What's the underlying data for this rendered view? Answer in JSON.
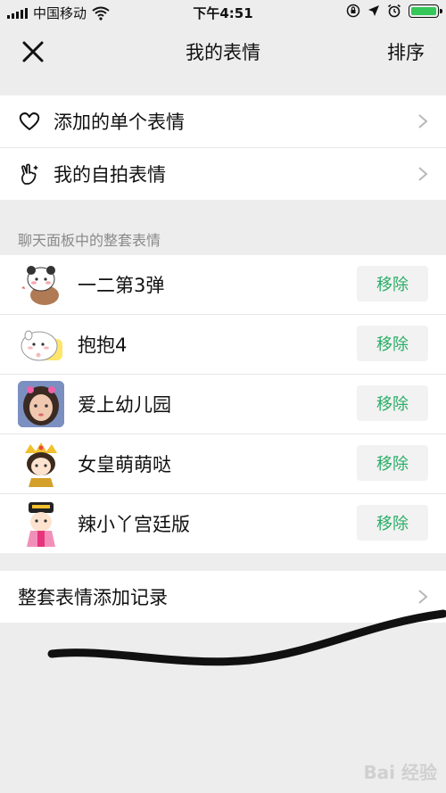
{
  "status_bar": {
    "carrier": "中国移动",
    "time": "下午4:51"
  },
  "header": {
    "title": "我的表情",
    "right_action": "排序"
  },
  "top_items": [
    {
      "label": "添加的单个表情",
      "icon": "heart-icon"
    },
    {
      "label": "我的自拍表情",
      "icon": "hand-icon"
    }
  ],
  "section": {
    "title": "聊天面板中的整套表情"
  },
  "packs": [
    {
      "name": "一二第3弹",
      "remove_label": "移除",
      "thumb": "bear-panda-sticker"
    },
    {
      "name": "抱抱4",
      "remove_label": "移除",
      "thumb": "round-character-sticker"
    },
    {
      "name": "爱上幼儿园",
      "remove_label": "移除",
      "thumb": "child-photo-sticker"
    },
    {
      "name": "女皇萌萌哒",
      "remove_label": "移除",
      "thumb": "empress-sticker"
    },
    {
      "name": "辣小丫宫廷版",
      "remove_label": "移除",
      "thumb": "palace-girl-sticker"
    }
  ],
  "bottom_item": {
    "label": "整套表情添加记录"
  },
  "colors": {
    "background": "#ededed",
    "remove_text": "#2aae67",
    "remove_bg": "#f2f2f2"
  },
  "watermark": "Bai 经验"
}
